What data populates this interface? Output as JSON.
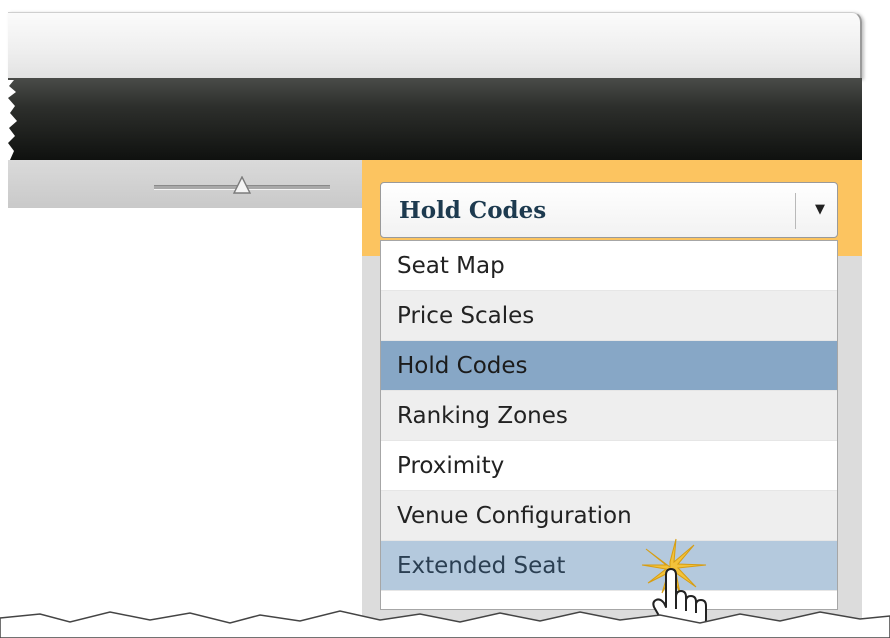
{
  "dropdown": {
    "selected_value": "Hold Codes",
    "arrow_glyph": "▼",
    "options": [
      {
        "label": "Seat Map",
        "state": "normal"
      },
      {
        "label": "Price Scales",
        "state": "alt"
      },
      {
        "label": "Hold Codes",
        "state": "selected"
      },
      {
        "label": "Ranking Zones",
        "state": "alt"
      },
      {
        "label": "Proximity",
        "state": "normal"
      },
      {
        "label": "Venue Configuration",
        "state": "alt"
      },
      {
        "label": "Extended Seat",
        "state": "hover"
      }
    ]
  },
  "slider": {
    "level": 0.5
  },
  "colors": {
    "header_dark": "#1a1c1a",
    "accent_orange": "#fcc460",
    "selected_row": "#87a7c6",
    "hover_row": "#b4c9dd",
    "select_text": "#1d3a4f"
  },
  "icons": [
    "hand-cursor-icon",
    "click-burst-icon",
    "dropdown-arrow-icon",
    "slider-thumb-icon"
  ]
}
